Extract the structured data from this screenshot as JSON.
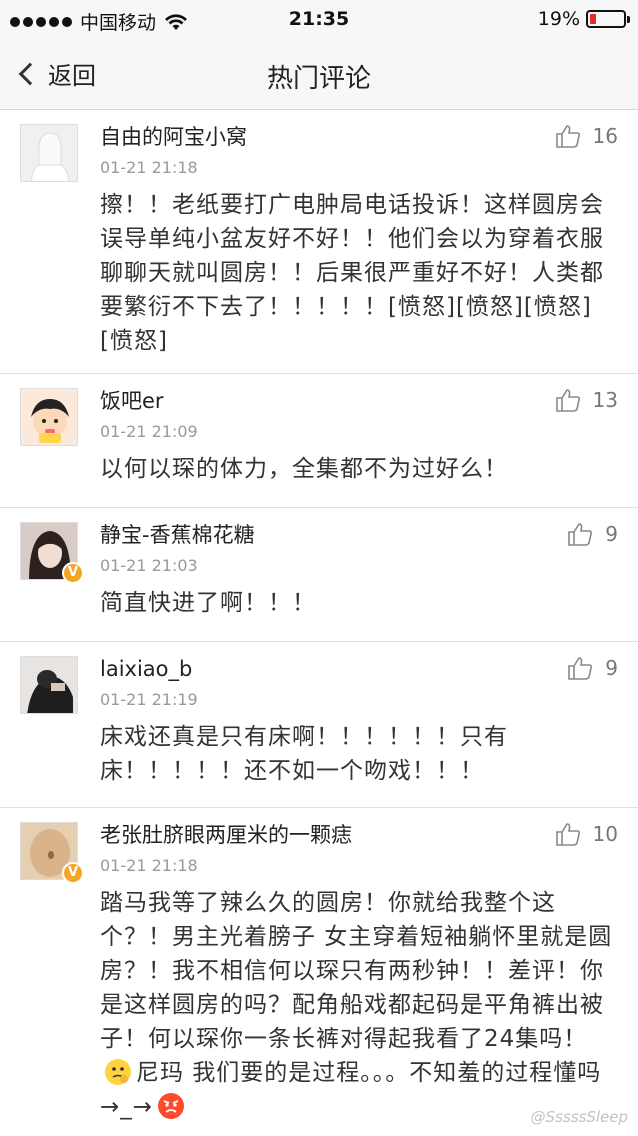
{
  "status_bar": {
    "carrier": "中国移动",
    "time": "21:35",
    "battery_percent_text": "19%",
    "battery_level": 0.19,
    "battery_color": "#e52b2b"
  },
  "nav": {
    "back_label": "返回",
    "title": "热门评论"
  },
  "comments": [
    {
      "username": "自由的阿宝小窝",
      "time": "01-21 21:18",
      "likes": "16",
      "verified": false,
      "avatar": "default-avatar-icon",
      "content": "擦！！老纸要打广电肿局电话投诉！这样圆房会误导单纯小盆友好不好！！他们会以为穿着衣服聊聊天就叫圆房！！后果很严重好不好！人类都要繁衍不下去了！！！！！[愤怒][愤怒][愤怒][愤怒]"
    },
    {
      "username": "饭吧er",
      "time": "01-21 21:09",
      "likes": "13",
      "verified": false,
      "avatar": "cartoon-avatar",
      "content": "以何以琛的体力，全集都不为过好么！"
    },
    {
      "username": "静宝-香蕉棉花糖",
      "time": "01-21 21:03",
      "likes": "9",
      "verified": true,
      "avatar": "photo-avatar",
      "content": "简直快进了啊！！！"
    },
    {
      "username": "laixiao_b",
      "time": "01-21 21:19",
      "likes": "9",
      "verified": false,
      "avatar": "photo-avatar",
      "content": "床戏还真是只有床啊！！！！！！只有床！！！！！还不如一个吻戏！！！"
    },
    {
      "username": "老张肚脐眼两厘米的一颗痣",
      "time": "01-21 21:18",
      "likes": "10",
      "verified": true,
      "avatar": "photo-avatar",
      "content_part1": "踏马我等了辣么久的圆房！你就给我整个这个？！男主光着膀子 女主穿着短袖躺怀里就是圆房？！我不相信何以琛只有两秒钟！！差评！你是这样圆房的吗？配角船戏都起码是平角裤出被子！何以琛你一条长裤对得起我看了24集吗！",
      "content_part2": "尼玛 我们要的是过程。。。不知羞的过程懂吗→_→",
      "emoji_1": "thinking-emoji-icon",
      "emoji_2": "angry-emoji-icon"
    }
  ],
  "watermark": "@SssssSleep"
}
